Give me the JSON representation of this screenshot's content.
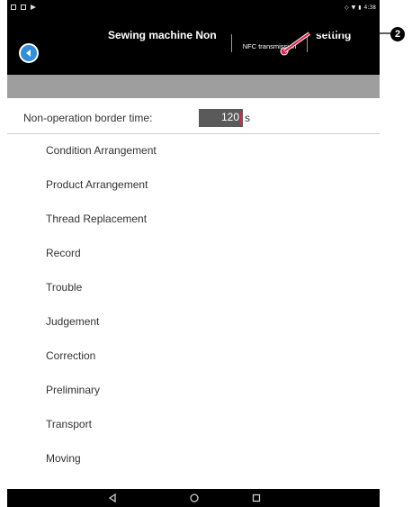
{
  "statusbar": {
    "time": "4:38"
  },
  "appbar": {
    "title": "Sewing machine Non",
    "title_end": "setting",
    "nfc_label": "NFC transmission"
  },
  "border_time": {
    "label": "Non-operation border time:",
    "value": "120",
    "unit": "s"
  },
  "menu": {
    "items": [
      "Condition Arrangement",
      "Product Arrangement",
      "Thread Replacement",
      "Record",
      "Trouble",
      "Judgement",
      "Correction",
      "Preliminary",
      "Transport",
      "Moving"
    ]
  },
  "callout": {
    "number": "2"
  },
  "colors": {
    "accent": "#2f8fd8",
    "callout": "#e0244a"
  }
}
